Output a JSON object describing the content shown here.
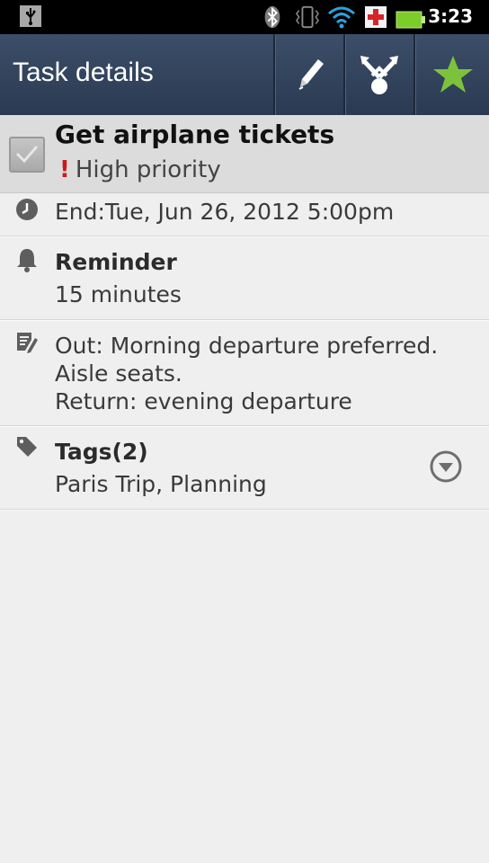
{
  "status_bar": {
    "time": "3:23",
    "icons": [
      "usb-icon",
      "bluetooth-icon",
      "vibrate-icon",
      "wifi-icon",
      "medical-icon",
      "battery-icon"
    ]
  },
  "action_bar": {
    "title": "Task details",
    "buttons": [
      "edit-icon",
      "share-icon",
      "star-icon"
    ]
  },
  "task": {
    "title": "Get airplane tickets",
    "priority": "High priority",
    "completed": false
  },
  "end": {
    "text": "End:Tue, Jun 26, 2012 5:00pm"
  },
  "reminder": {
    "label": "Reminder",
    "value": "15 minutes"
  },
  "notes": {
    "line1": "Out: Morning departure preferred.",
    "line2": "Aisle seats.",
    "line3": "Return: evening departure"
  },
  "tags": {
    "label": "Tags(2)",
    "value": "Paris Trip, Planning"
  },
  "colors": {
    "actionbar": "#34465f",
    "star": "#7cc33b",
    "priority": "#cc1a1a"
  }
}
